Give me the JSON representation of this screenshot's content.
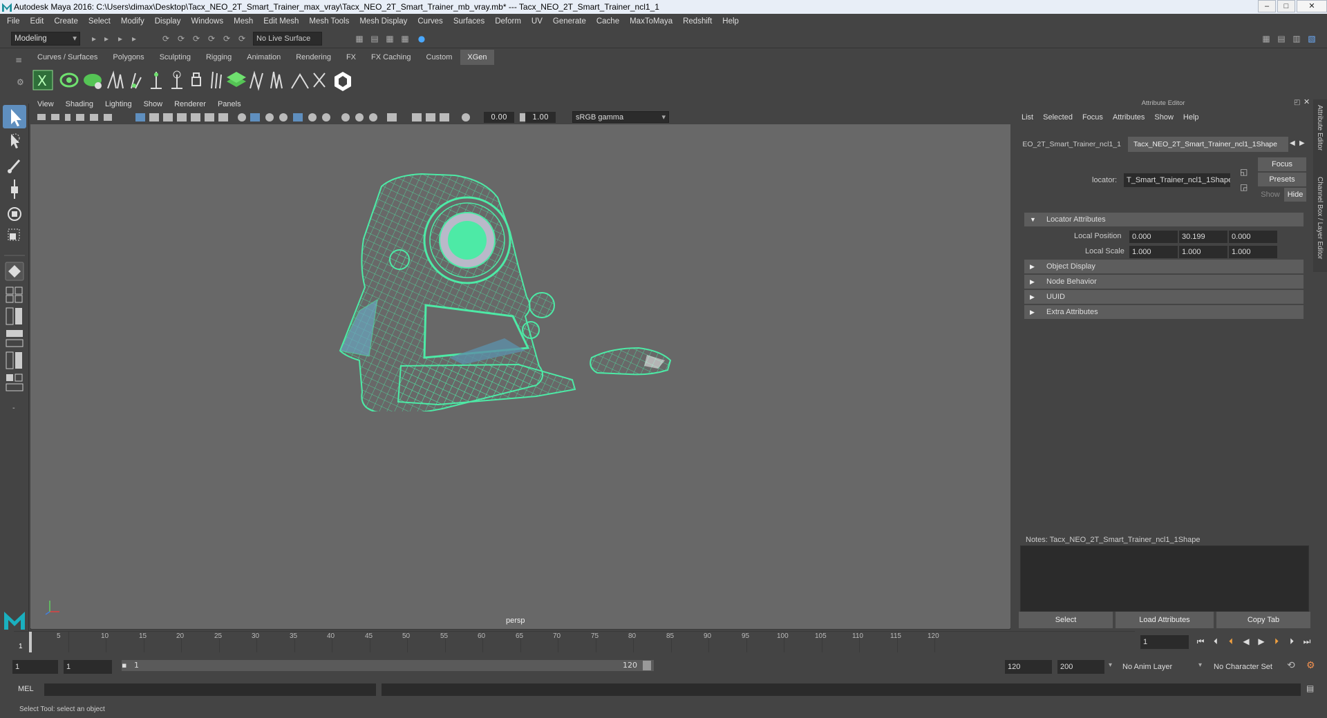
{
  "window": {
    "title": "Autodesk Maya 2016: C:\\Users\\dimax\\Desktop\\Tacx_NEO_2T_Smart_Trainer_max_vray\\Tacx_NEO_2T_Smart_Trainer_mb_vray.mb*   ---   Tacx_NEO_2T_Smart_Trainer_ncl1_1",
    "minimize": "–",
    "maximize": "□",
    "close": "✕"
  },
  "menubar": [
    "File",
    "Edit",
    "Create",
    "Select",
    "Modify",
    "Display",
    "Windows",
    "Mesh",
    "Edit Mesh",
    "Mesh Tools",
    "Mesh Display",
    "Curves",
    "Surfaces",
    "Deform",
    "UV",
    "Generate",
    "Cache",
    "MaxToMaya",
    "Redshift",
    "Help"
  ],
  "statusline": {
    "mode": "Modeling",
    "live_surface": "No Live Surface"
  },
  "shelf_tabs": [
    "Curves / Surfaces",
    "Polygons",
    "Sculpting",
    "Rigging",
    "Animation",
    "Rendering",
    "FX",
    "FX Caching",
    "Custom",
    "XGen"
  ],
  "shelf_active": "XGen",
  "viewport": {
    "menu": [
      "View",
      "Shading",
      "Lighting",
      "Show",
      "Renderer",
      "Panels"
    ],
    "exposure": "0.00",
    "gamma_value": "1.00",
    "color_space": "sRGB gamma",
    "camera_label": "persp",
    "wire_color": "#4deaa6"
  },
  "attribute_editor": {
    "title": "Attribute Editor",
    "menu": [
      "List",
      "Selected",
      "Focus",
      "Attributes",
      "Show",
      "Help"
    ],
    "tab_inactive": "EO_2T_Smart_Trainer_ncl1_1",
    "tab_active": "Tacx_NEO_2T_Smart_Trainer_ncl1_1Shape",
    "locator_label": "locator:",
    "locator_value": "T_Smart_Trainer_ncl1_1Shape",
    "focus_btn": "Focus",
    "presets_btn": "Presets",
    "show_btn": "Show",
    "hide_btn": "Hide",
    "sections": {
      "locator": "Locator Attributes",
      "object_display": "Object Display",
      "node_behavior": "Node Behavior",
      "uuid": "UUID",
      "extra": "Extra Attributes"
    },
    "local_position_label": "Local Position",
    "local_position": [
      "0.000",
      "30.199",
      "0.000"
    ],
    "local_scale_label": "Local Scale",
    "local_scale": [
      "1.000",
      "1.000",
      "1.000"
    ],
    "notes_label": "Notes:  Tacx_NEO_2T_Smart_Trainer_ncl1_1Shape",
    "bottom_buttons": [
      "Select",
      "Load Attributes",
      "Copy Tab"
    ],
    "side_tabs": [
      "Attribute Editor",
      "Channel Box / Layer Editor"
    ]
  },
  "timeline": {
    "ticks": [
      "5",
      "10",
      "15",
      "20",
      "25",
      "30",
      "35",
      "40",
      "45",
      "50",
      "55",
      "60",
      "65",
      "70",
      "75",
      "80",
      "85",
      "90",
      "95",
      "100",
      "105",
      "110",
      "115",
      "120"
    ],
    "start_tick": "1",
    "current_frame": "1"
  },
  "range": {
    "start": "1",
    "playback_start": "1",
    "range_start": "1",
    "range_end": "120",
    "playback_end": "120",
    "end": "200",
    "anim_layer": "No Anim Layer",
    "character_set": "No Character Set"
  },
  "command_line": {
    "label": "MEL"
  },
  "help_line": "Select Tool: select an object"
}
